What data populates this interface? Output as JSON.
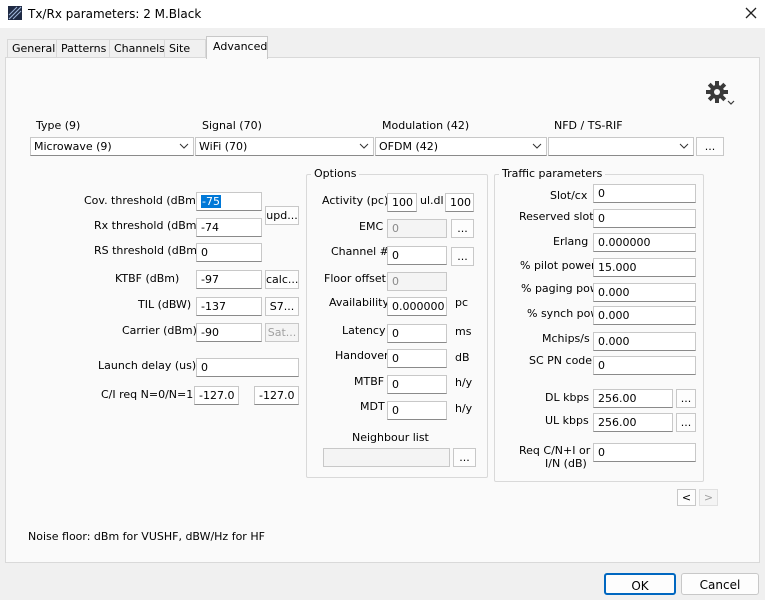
{
  "window": {
    "title": "Tx/Rx parameters: 2 M.Black",
    "close_icon": "close-icon"
  },
  "tabs": [
    {
      "label": "General",
      "active": false
    },
    {
      "label": "Patterns",
      "active": false
    },
    {
      "label": "Channels",
      "active": false
    },
    {
      "label": "Site",
      "active": false
    },
    {
      "label": "Advanced",
      "active": true
    }
  ],
  "settings_icon": "gear-icon",
  "selectors": {
    "type": {
      "label": "Type (9)",
      "value": "Microwave (9)"
    },
    "signal": {
      "label": "Signal (70)",
      "value": "WiFi (70)"
    },
    "modulation": {
      "label": "Modulation (42)",
      "value": "OFDM (42)"
    },
    "nfd": {
      "label": "NFD / TS-RIF",
      "value": "",
      "button": "..."
    }
  },
  "left": {
    "cov_threshold": {
      "label": "Cov. threshold (dBm)",
      "value": "-75"
    },
    "rx_threshold": {
      "label": "Rx threshold (dBm)",
      "value": "-74"
    },
    "rs_threshold": {
      "label": "RS threshold (dBm)",
      "value": "0"
    },
    "upd_button": "upd...",
    "ktbf": {
      "label": "KTBF (dBm)",
      "value": "-97",
      "button": "calc..."
    },
    "til": {
      "label": "TIL (dBW)",
      "value": "-137",
      "button": "S7..."
    },
    "carrier": {
      "label": "Carrier (dBm)",
      "value": "-90",
      "button": "Sat..."
    },
    "launch_delay": {
      "label": "Launch delay  (us)",
      "value": "0"
    },
    "ci_req": {
      "label": "C/I req N=0/N=1",
      "value0": "-127.0",
      "value1": "-127.0"
    }
  },
  "options": {
    "title": "Options",
    "activity": {
      "label": "Activity (pc)",
      "value_ul": "100",
      "mid": "ul.dl",
      "value_dl": "100"
    },
    "emc": {
      "label": "EMC",
      "value": "0",
      "button": "..."
    },
    "channel": {
      "label": "Channel #",
      "value": "0",
      "button": "..."
    },
    "floor_offset": {
      "label": "Floor offset",
      "value": "0"
    },
    "availability": {
      "label": "Availability",
      "value": "0.000000",
      "unit": "pc"
    },
    "latency": {
      "label": "Latency",
      "value": "0",
      "unit": "ms"
    },
    "handover": {
      "label": "Handover",
      "value": "0",
      "unit": "dB"
    },
    "mtbf": {
      "label": "MTBF",
      "value": "0",
      "unit": "h/y"
    },
    "mdt": {
      "label": "MDT",
      "value": "0",
      "unit": "h/y"
    },
    "neighbour": {
      "label": "Neighbour list",
      "value": "",
      "button": "..."
    }
  },
  "traffic": {
    "title": "Traffic parameters",
    "slot_cx": {
      "label": "Slot/cx",
      "value": "0"
    },
    "reserved_slot": {
      "label": "Reserved slot",
      "value": "0"
    },
    "erlang": {
      "label": "Erlang",
      "value": "0.000000"
    },
    "pilot_power": {
      "label": "% pilot power",
      "value": "15.000"
    },
    "paging_pow": {
      "label": "% paging pow",
      "value": "0.000"
    },
    "synch_pow": {
      "label": "% synch pow",
      "value": "0.000"
    },
    "mchips": {
      "label": "Mchips/s",
      "value": "0.000"
    },
    "sc_pn": {
      "label": "SC PN code",
      "value": "0"
    },
    "dl_kbps": {
      "label": "DL kbps",
      "value": "256.00",
      "button": "..."
    },
    "ul_kbps": {
      "label": "UL kbps",
      "value": "256.00",
      "button": "..."
    },
    "req_cn_line1": "Req C/N+I or",
    "req_cn_line2": "I/N (dB)",
    "req_cn_value": "0"
  },
  "nav": {
    "prev": "<",
    "next": ">"
  },
  "footnote": "Noise floor: dBm for VUSHF, dBW/Hz for HF",
  "footer": {
    "ok": "OK",
    "cancel": "Cancel"
  }
}
